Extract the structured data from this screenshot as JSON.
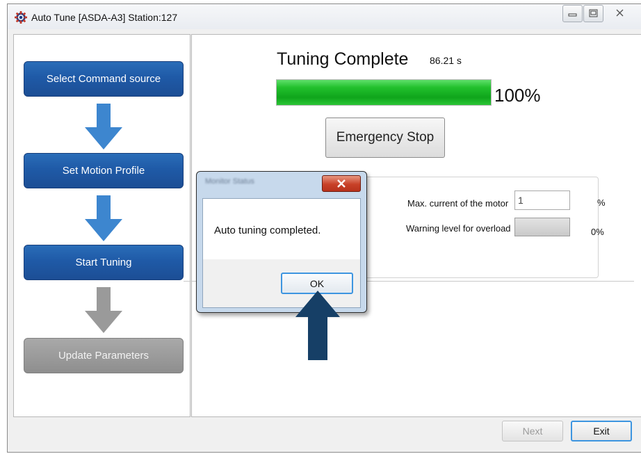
{
  "window": {
    "title": "Auto Tune [ASDA-A3] Station:127",
    "app_icon": "gear-icon",
    "controls": [
      "minimize-icon",
      "maximize-icon",
      "close-icon"
    ]
  },
  "steps": [
    {
      "label": "Select Command source",
      "state": "done"
    },
    {
      "label": "Set Motion Profile",
      "state": "done"
    },
    {
      "label": "Start Tuning",
      "state": "done"
    },
    {
      "label": "Update Parameters",
      "state": "pending"
    }
  ],
  "colors": {
    "step_active": "#1f5aa7",
    "step_inactive": "#999999",
    "arrow_active": "#3d86cf",
    "arrow_inactive": "#9a9a9a",
    "progress": "#22c02d",
    "pointer_arrow": "#163f66"
  },
  "tuning": {
    "title": "Tuning Complete",
    "elapsed": "86.21 s",
    "progress_percent": 100,
    "progress_label": "100%",
    "emergency_stop_label": "Emergency Stop"
  },
  "monitor": {
    "max_current_label": "Max. current of the motor",
    "max_current_value": "1",
    "max_current_unit": "%",
    "overload_label": "Warning level for overload",
    "overload_value": "0%"
  },
  "dialog": {
    "message": "Auto tuning completed.",
    "ok_label": "OK"
  },
  "footer": {
    "next_label": "Next",
    "exit_label": "Exit"
  }
}
